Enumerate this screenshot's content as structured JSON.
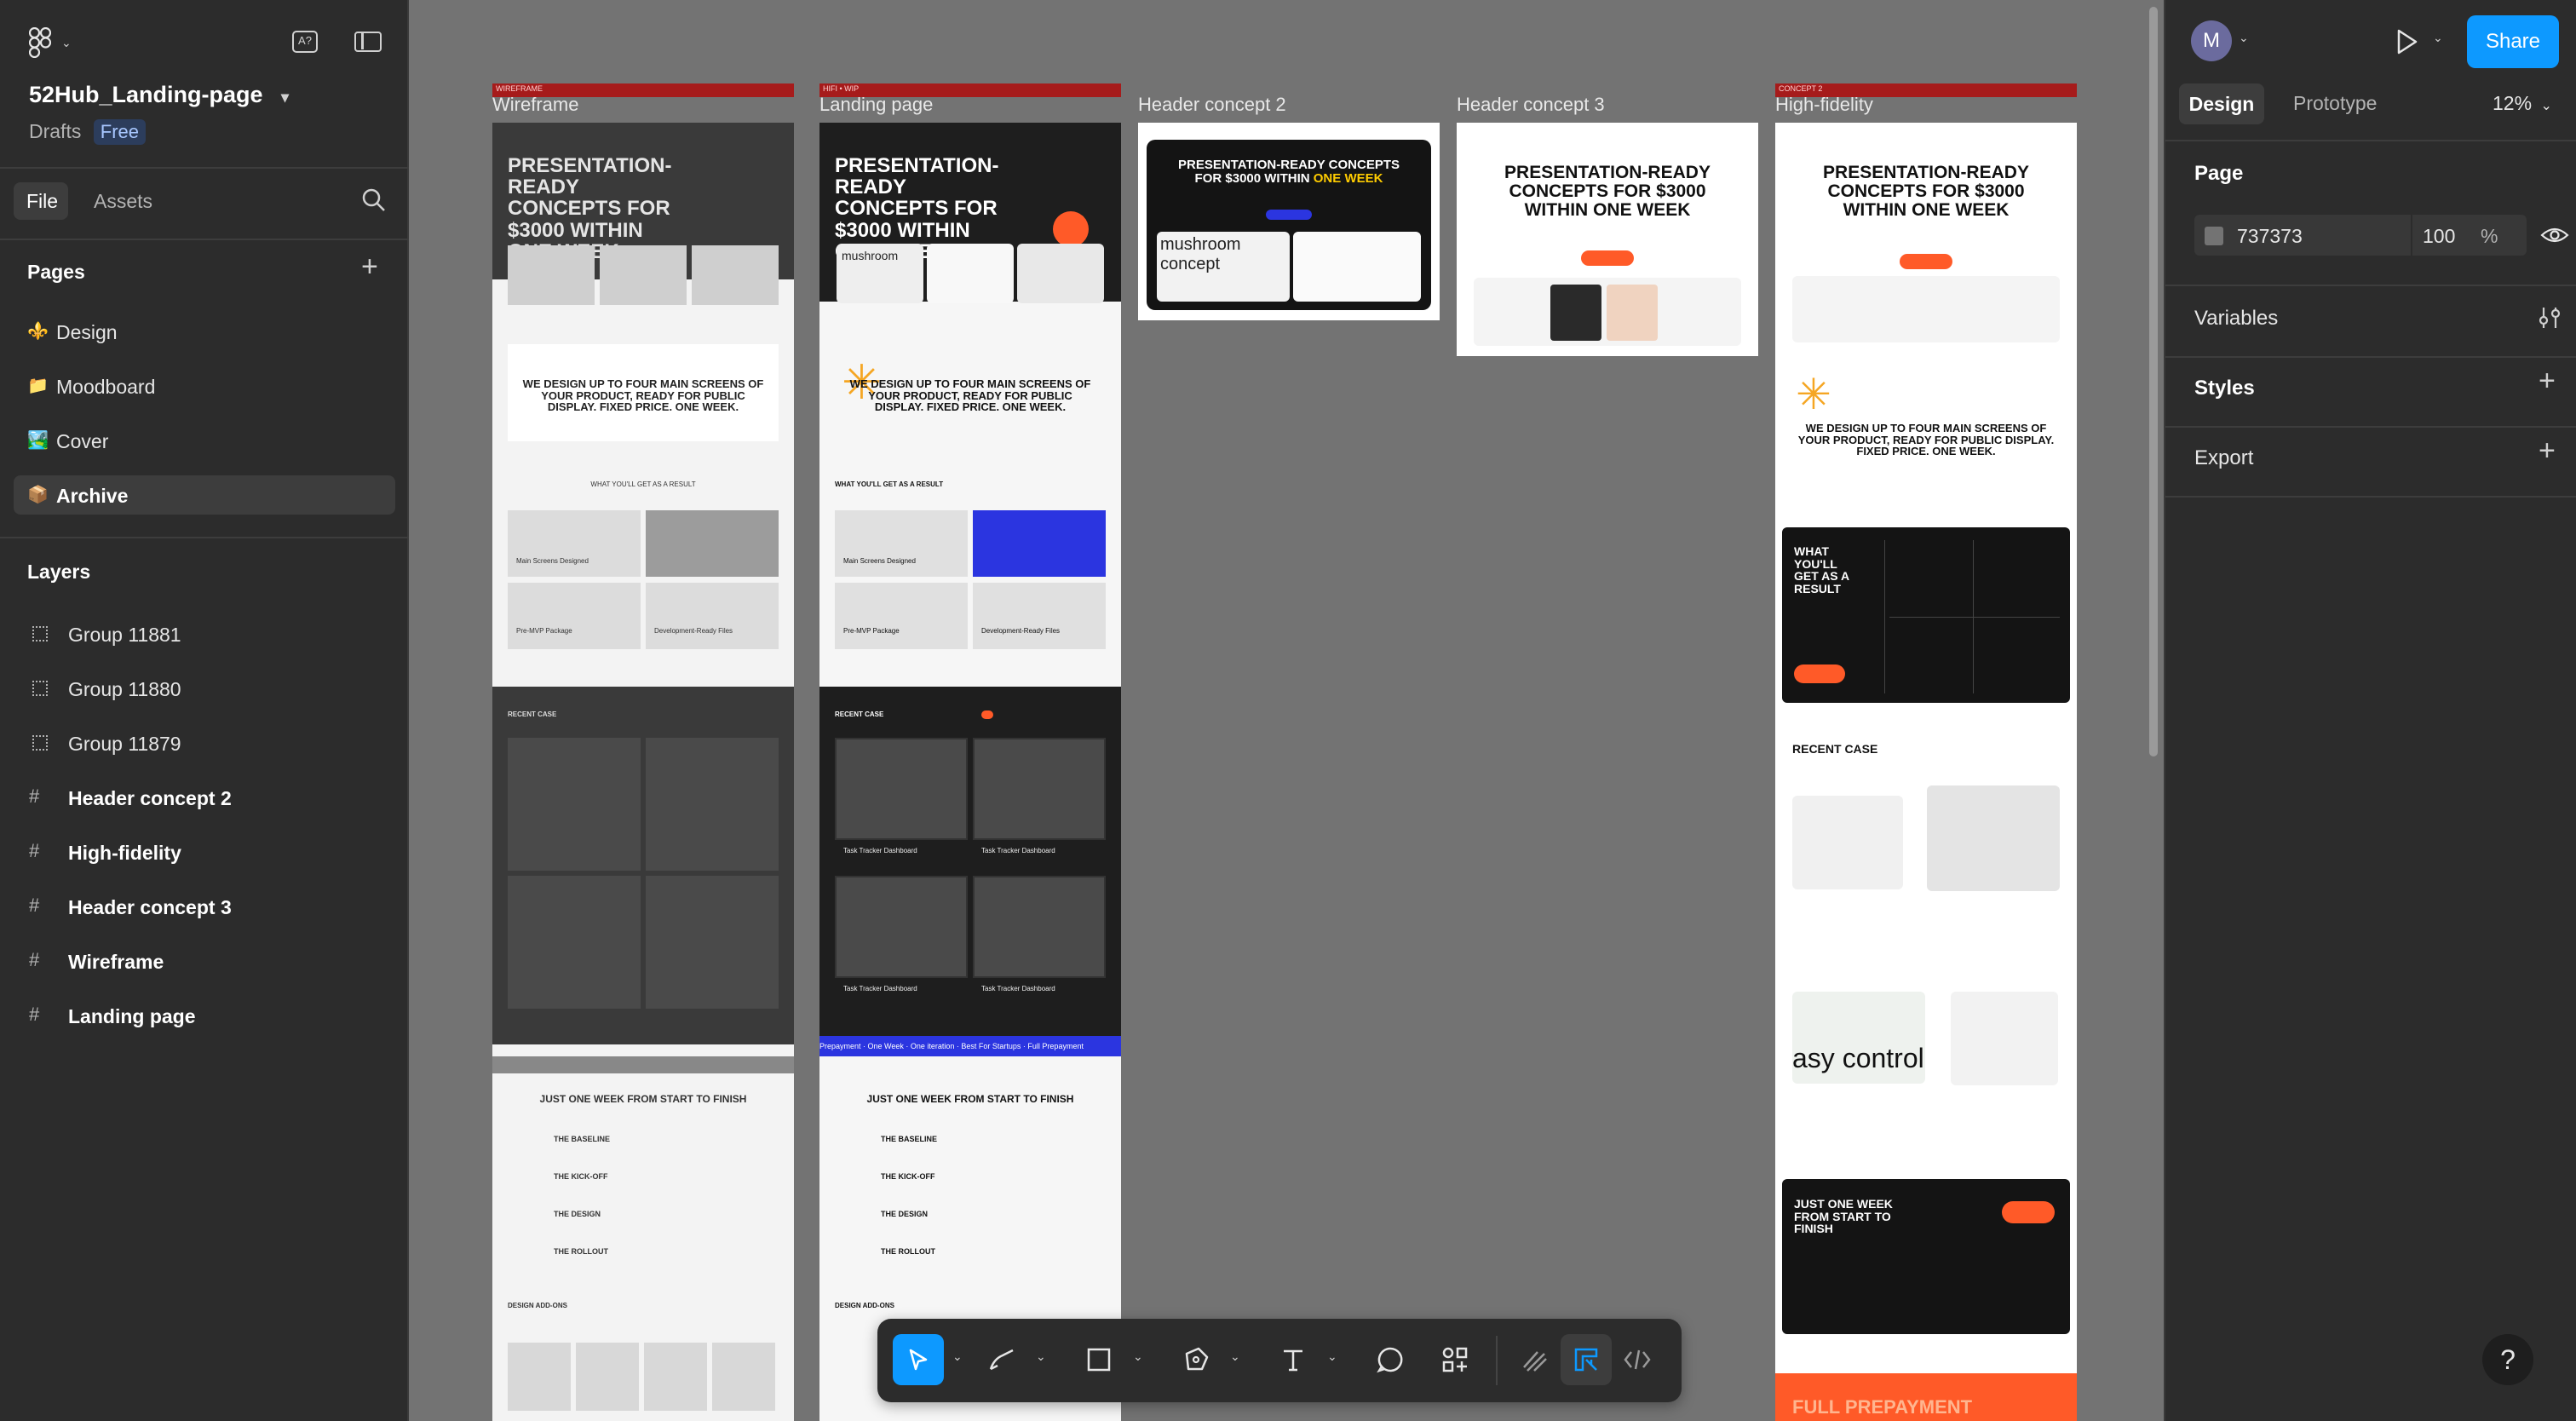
{
  "file": {
    "name": "52Hub_Landing-page",
    "location": "Drafts",
    "plan": "Free"
  },
  "left_tabs": {
    "file": "File",
    "assets": "Assets"
  },
  "pages": {
    "heading": "Pages",
    "items": [
      {
        "icon": "⚜️",
        "label": "Design"
      },
      {
        "icon": "📁",
        "label": "Moodboard"
      },
      {
        "icon": "🏞️",
        "label": "Cover"
      },
      {
        "icon": "📦",
        "label": "Archive"
      }
    ]
  },
  "layers": {
    "heading": "Layers",
    "items": [
      {
        "label": "Group 11881"
      },
      {
        "label": "Group 11880"
      },
      {
        "label": "Group 11879"
      },
      {
        "label": "Header  concept 2"
      },
      {
        "label": "High-fidelity"
      },
      {
        "label": "Header concept 3"
      },
      {
        "label": "Wireframe"
      },
      {
        "label": "Landing page"
      }
    ]
  },
  "user": {
    "avatar_initial": "M"
  },
  "share_label": "Share",
  "right_tabs": {
    "design": "Design",
    "prototype": "Prototype",
    "zoom": "12%"
  },
  "page_props": {
    "heading": "Page",
    "fill_hex": "737373",
    "opacity": "100",
    "percent": "%"
  },
  "sections": {
    "variables": "Variables",
    "styles": "Styles",
    "export": "Export"
  },
  "canvas": {
    "frames": [
      {
        "title": "Wireframe",
        "tag": "WIREFRAME"
      },
      {
        "title": "Landing page",
        "tag": "HIFI • WIP"
      },
      {
        "title": "Header  concept 2"
      },
      {
        "title": "Header concept 3"
      },
      {
        "title": "High-fidelity",
        "tag": "CONCEPT 2"
      }
    ],
    "texts": {
      "hero_a": "PRESENTATION-READY CONCEPTS FOR",
      "hero_price": "$3000 WITHIN",
      "hero_week": "ONE WEEK",
      "design_up": "WE DESIGN UP TO FOUR MAIN SCREENS OF YOUR PRODUCT, READY FOR PUBLIC DISPLAY. FIXED PRICE. ONE WEEK.",
      "result": "WHAT YOU'LL GET AS A RESULT",
      "main_screens": "Main Screens Designed",
      "pre_mvp": "Pre-MVP Package",
      "dev_files": "Development-Ready Files",
      "recent_case": "RECENT CASE",
      "task_tracker": "Task Tracker Dashboard",
      "one_week_finish": "JUST ONE WEEK FROM START TO FINISH",
      "baseline": "THE BASELINE",
      "kickoff": "THE KICK-OFF",
      "the_design": "THE DESIGN",
      "rollout": "THE ROLLOUT",
      "design_addons": "DESIGN ADD-ONS",
      "ticker": "Prepayment  ·  One Week  ·  One iteration  ·  Best For Startups  ·  Full Prepayment",
      "hf_what": "WHAT YOU'LL GET AS A RESULT",
      "hf_recent": "RECENT CASE",
      "hf_just": "JUST ONE WEEK FROM START TO FINISH",
      "full_prepay": "FULL PREPAYMENT",
      "mushroom": "mushroom",
      "concept": "concept",
      "easy": "asy controll"
    }
  },
  "toolbar": {
    "tools": [
      "move-tool",
      "pencil-tool",
      "frame-tool",
      "pen-tool",
      "text-tool",
      "comment-tool",
      "actions-tool",
      "draw-mode",
      "design-mode",
      "dev-mode"
    ]
  },
  "help_label": "?",
  "colors": {
    "accent": "#0d99ff",
    "panel": "#2c2c2c",
    "canvas": "#737373",
    "orange": "#ff5a28",
    "blue": "#2b35e0",
    "frame_bar": "#a61b1b"
  }
}
